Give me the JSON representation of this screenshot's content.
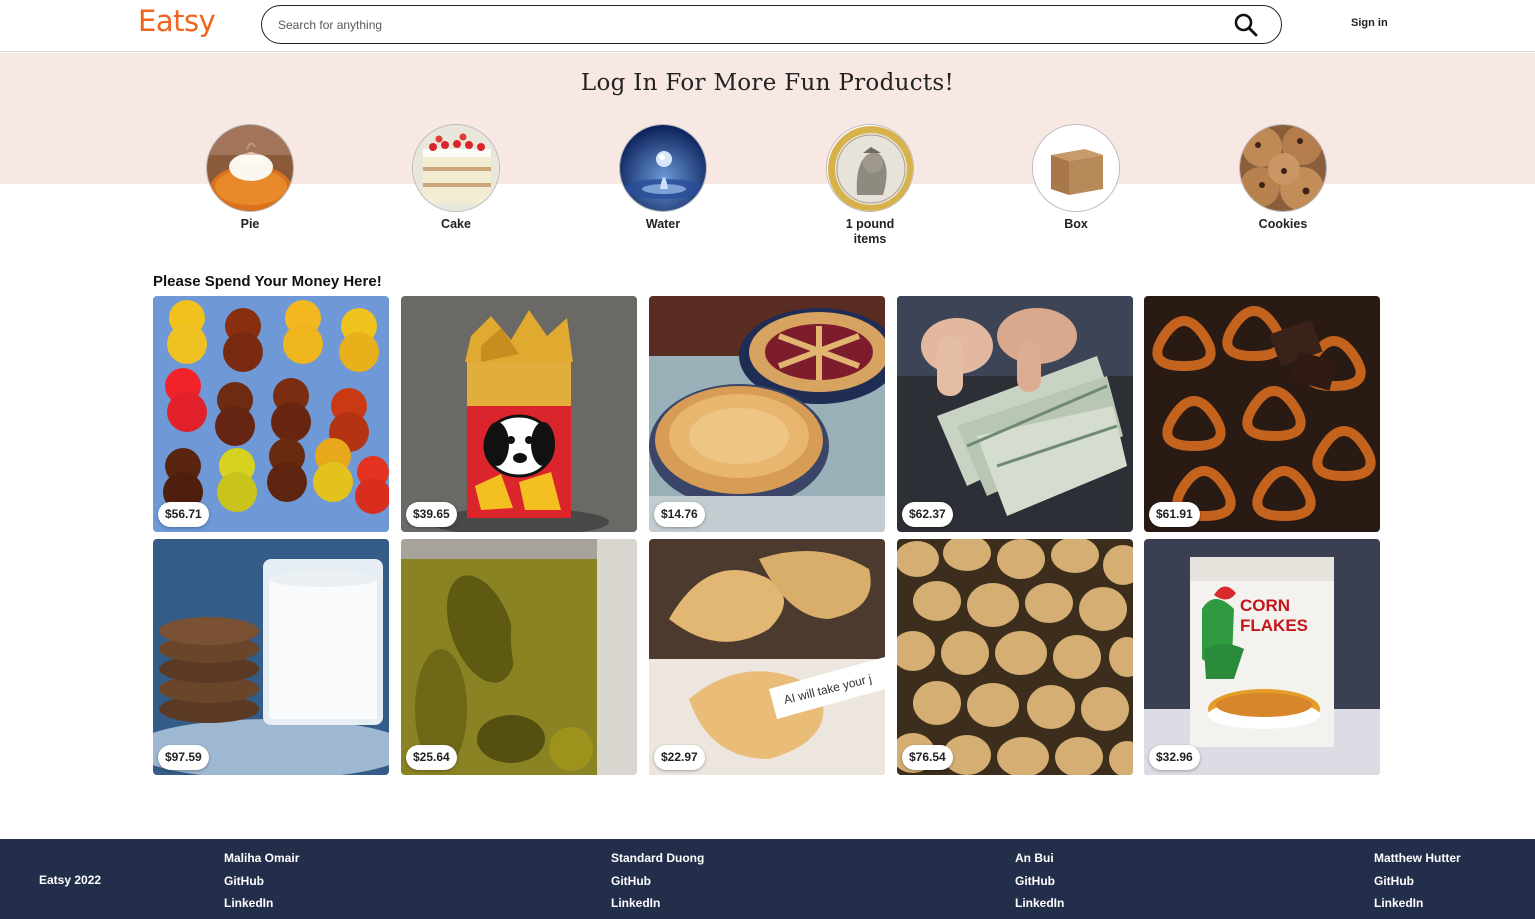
{
  "header": {
    "logo": "Eatsy",
    "search_placeholder": "Search for anything",
    "search_value": "",
    "sign_in": "Sign in"
  },
  "banner": {
    "title": "Log In For More Fun Products!",
    "categories": [
      {
        "label": "Pie",
        "icon": "pie-image"
      },
      {
        "label": "Cake",
        "icon": "cake-image"
      },
      {
        "label": "Water",
        "icon": "water-drop-image"
      },
      {
        "label": "1 pound items",
        "icon": "pound-coin-image"
      },
      {
        "label": "Box",
        "icon": "box-image"
      },
      {
        "label": "Cookies",
        "icon": "cookies-image"
      }
    ]
  },
  "main": {
    "section_title": "Please Spend Your Money Here!",
    "products": [
      {
        "price": "$56.71",
        "image": "gummy-bears"
      },
      {
        "price": "$39.65",
        "image": "chips-bag"
      },
      {
        "price": "$14.76",
        "image": "pies"
      },
      {
        "price": "$62.37",
        "image": "money"
      },
      {
        "price": "$61.91",
        "image": "chocolate-pretzels"
      },
      {
        "price": "$97.59",
        "image": "cookies-and-milk"
      },
      {
        "price": "$25.64",
        "image": "pickles-jar"
      },
      {
        "price": "$22.97",
        "image": "fortune-cookies",
        "image_text": "AI will take your j"
      },
      {
        "price": "$76.54",
        "image": "potatoes"
      },
      {
        "price": "$32.96",
        "image": "corn-flakes",
        "image_text": "CORN FLAKES"
      }
    ]
  },
  "footer": {
    "brand": "Eatsy 2022",
    "people": [
      {
        "name": "Maliha Omair",
        "github": "GitHub",
        "linkedin": "LinkedIn"
      },
      {
        "name": "Standard Duong",
        "github": "GitHub",
        "linkedin": "LinkedIn"
      },
      {
        "name": "An Bui",
        "github": "GitHub",
        "linkedin": "LinkedIn"
      },
      {
        "name": "Matthew Hutter",
        "github": "GitHub",
        "linkedin": "LinkedIn"
      }
    ]
  },
  "colors": {
    "brand": "#f1641e",
    "banner_bg": "#f8e8e3",
    "footer_bg": "#232f4a"
  }
}
